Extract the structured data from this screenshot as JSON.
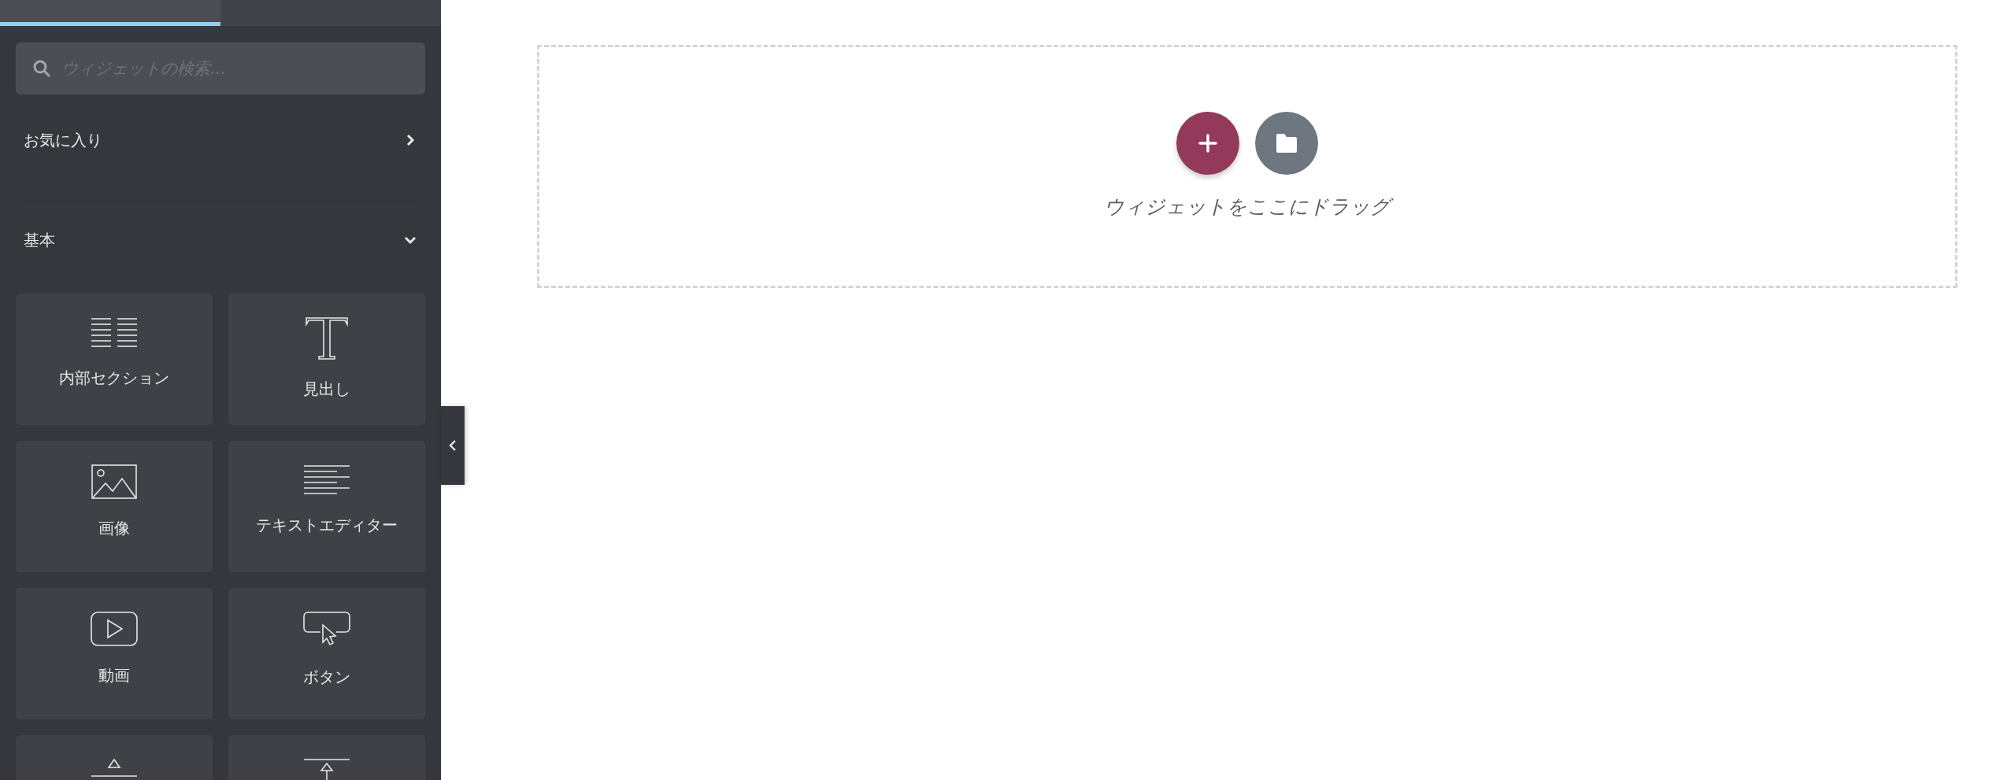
{
  "sidebar": {
    "tabs": [
      {
        "selected": true
      },
      {
        "selected": false
      }
    ],
    "search": {
      "placeholder": "ウィジェットの検索..."
    },
    "categories": [
      {
        "label": "お気に入り",
        "expanded": false
      },
      {
        "label": "基本",
        "expanded": true
      }
    ],
    "widgets": [
      {
        "kind": "inner-section",
        "label": "内部セクション"
      },
      {
        "kind": "heading",
        "label": "見出し"
      },
      {
        "kind": "image",
        "label": "画像"
      },
      {
        "kind": "text-editor",
        "label": "テキストエディター"
      },
      {
        "kind": "video",
        "label": "動画"
      },
      {
        "kind": "button",
        "label": "ボタン"
      },
      {
        "kind": "divider"
      },
      {
        "kind": "spacer"
      }
    ]
  },
  "canvas": {
    "drop_hint": "ウィジェットをここにドラッグ"
  }
}
